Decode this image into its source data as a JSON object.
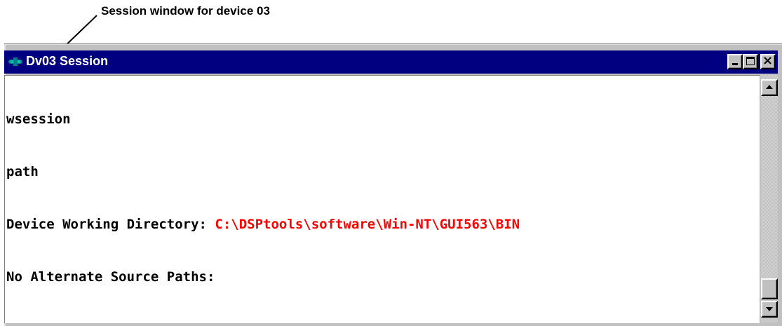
{
  "callout": {
    "label": "Session window for device 03"
  },
  "window": {
    "title": "Dv03 Session",
    "icon": "device-session-icon",
    "title_bar_color": "#000080",
    "buttons": {
      "minimize": "minimize-icon",
      "maximize": "maximize-icon",
      "close": "close-icon",
      "close_glyph": "×"
    }
  },
  "console": {
    "lines": [
      {
        "text": "wsession"
      },
      {
        "text": "path"
      },
      {
        "text": "Device Working Directory: ",
        "value": "C:\\DSPtools\\software\\Win-NT\\GUI563\\BIN",
        "value_color": "#ff0000"
      },
      {
        "text": "No Alternate Source Paths:"
      }
    ]
  },
  "scrollbar": {
    "up_icon": "arrow-up-icon",
    "down_icon": "arrow-down-icon"
  }
}
